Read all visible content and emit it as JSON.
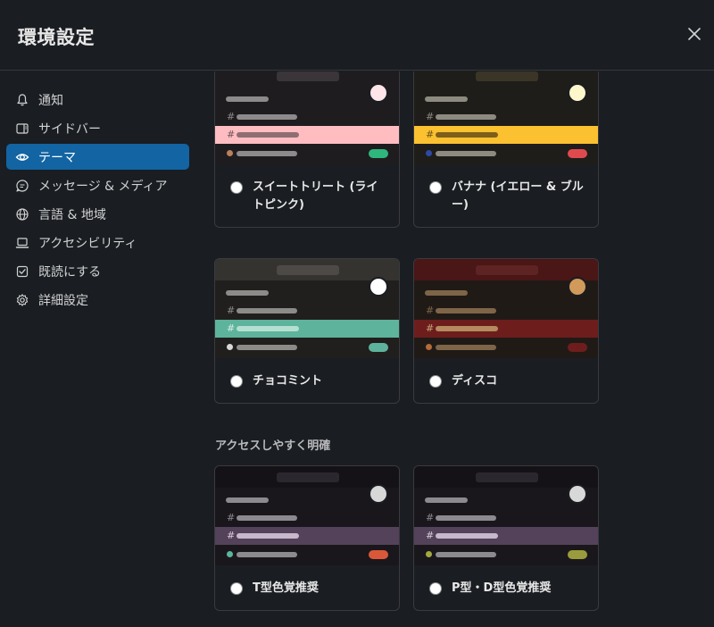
{
  "modal": {
    "title": "環境設定",
    "close_icon": "close-icon"
  },
  "sidebar": {
    "items": [
      {
        "label": "通知",
        "icon": "bell-icon",
        "active": false
      },
      {
        "label": "サイドバー",
        "icon": "sidebar-icon",
        "active": false
      },
      {
        "label": "テーマ",
        "icon": "eye-icon",
        "active": true
      },
      {
        "label": "メッセージ & メディア",
        "icon": "message-icon",
        "active": false
      },
      {
        "label": "言語 & 地域",
        "icon": "globe-icon",
        "active": false
      },
      {
        "label": "アクセシビリティ",
        "icon": "laptop-icon",
        "active": false
      },
      {
        "label": "既読にする",
        "icon": "checkbox-icon",
        "active": false
      },
      {
        "label": "詳細設定",
        "icon": "gear-icon",
        "active": false
      }
    ]
  },
  "themes": {
    "cards": [
      {
        "name": "スイートトリート (ライトピンク)",
        "colors": {
          "top": "#1f1c20",
          "search": "#3a3539",
          "body": "#1f1c20",
          "avatar": "#fde5e9",
          "line": "#8d8a8c",
          "hl": "#ffbdc2",
          "hlbar": "#8e6e72",
          "hlhash": "#6d5559",
          "dot": "#b9805b",
          "pill": "#2eb67d"
        }
      },
      {
        "name": "バナナ (イエロー & ブルー)",
        "colors": {
          "top": "#1f1d1a",
          "search": "#3a3526",
          "body": "#1f1d1a",
          "avatar": "#fff7cc",
          "line": "#8d8a80",
          "hl": "#fbc130",
          "hlbar": "#7d5f1a",
          "hlhash": "#6b5116",
          "dot": "#2c4aa3",
          "pill": "#e04a4f"
        }
      },
      {
        "name": "チョコミント",
        "colors": {
          "top": "#353330",
          "search": "#4c4946",
          "body": "#201f1d",
          "avatar": "#ffffff",
          "line": "#8d8b88",
          "hl": "#5db39b",
          "hlbar": "#b5dfd0",
          "hlhash": "#d6ede6",
          "dot": "#d8d8d8",
          "pill": "#5db39b"
        }
      },
      {
        "name": "ディスコ",
        "colors": {
          "top": "#4a1616",
          "search": "#5e2323",
          "body": "#201a17",
          "avatar": "#d19a5a",
          "line": "#7e6548",
          "hl": "#6e1d1d",
          "hlbar": "#b48a5e",
          "hlhash": "#c9a37a",
          "dot": "#b46a3a",
          "pill": "#6e1d1d"
        }
      },
      {
        "name": "T型色覚推奨",
        "colors": {
          "top": "#141217",
          "search": "#2b272e",
          "body": "#1a171c",
          "avatar": "#d8d8d8",
          "line": "#8d8a8f",
          "hl": "#54415a",
          "hlbar": "#c7b8cc",
          "hlhash": "#d9cfdc",
          "dot": "#5ab69a",
          "pill": "#d9583a"
        }
      },
      {
        "name": "P型・D型色覚推奨",
        "colors": {
          "top": "#141217",
          "search": "#2b272e",
          "body": "#1a171c",
          "avatar": "#d8d8d8",
          "line": "#8d8a8f",
          "hl": "#54415a",
          "hlbar": "#c7b8cc",
          "hlhash": "#d9cfdc",
          "dot": "#a3a83f",
          "pill": "#9a9b3c"
        }
      }
    ],
    "section_heading": "アクセスしやすく明確"
  }
}
